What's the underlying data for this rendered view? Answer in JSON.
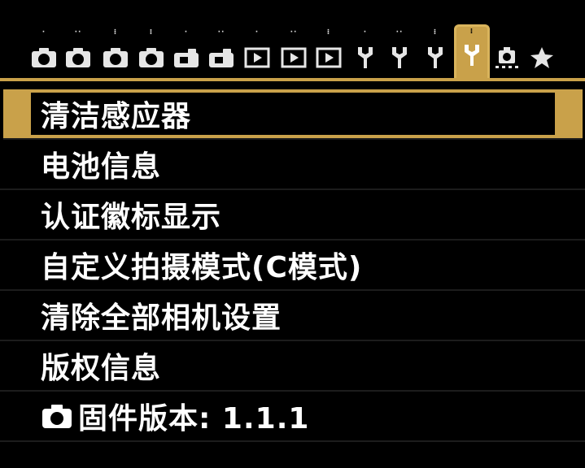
{
  "tabs": [
    {
      "kind": "camera",
      "dots": "·"
    },
    {
      "kind": "camera",
      "dots": "··"
    },
    {
      "kind": "camera",
      "dots": "⁝"
    },
    {
      "kind": "camera",
      "dots": "⁞"
    },
    {
      "kind": "video",
      "dots": "·"
    },
    {
      "kind": "video",
      "dots": "··"
    },
    {
      "kind": "play",
      "dots": "·"
    },
    {
      "kind": "play",
      "dots": "··"
    },
    {
      "kind": "play",
      "dots": "⁝"
    },
    {
      "kind": "wrench",
      "dots": "·"
    },
    {
      "kind": "wrench",
      "dots": "··"
    },
    {
      "kind": "wrench",
      "dots": "⁝"
    },
    {
      "kind": "wrench",
      "dots": "⁞",
      "active": true
    },
    {
      "kind": "custom",
      "dots": ""
    },
    {
      "kind": "star",
      "dots": ""
    }
  ],
  "menu": {
    "items": [
      {
        "label": "清洁感应器"
      },
      {
        "label": "电池信息"
      },
      {
        "label": "认证徽标显示"
      },
      {
        "label": "自定义拍摄模式(C模式)"
      },
      {
        "label": "清除全部相机设置"
      },
      {
        "label": "版权信息"
      },
      {
        "label": "固件版本: 1.1.1",
        "icon": "camera-icon"
      }
    ],
    "selected_index": 0
  },
  "colors": {
    "accent": "#c9a14a",
    "background": "#000000",
    "text": "#ffffff"
  }
}
